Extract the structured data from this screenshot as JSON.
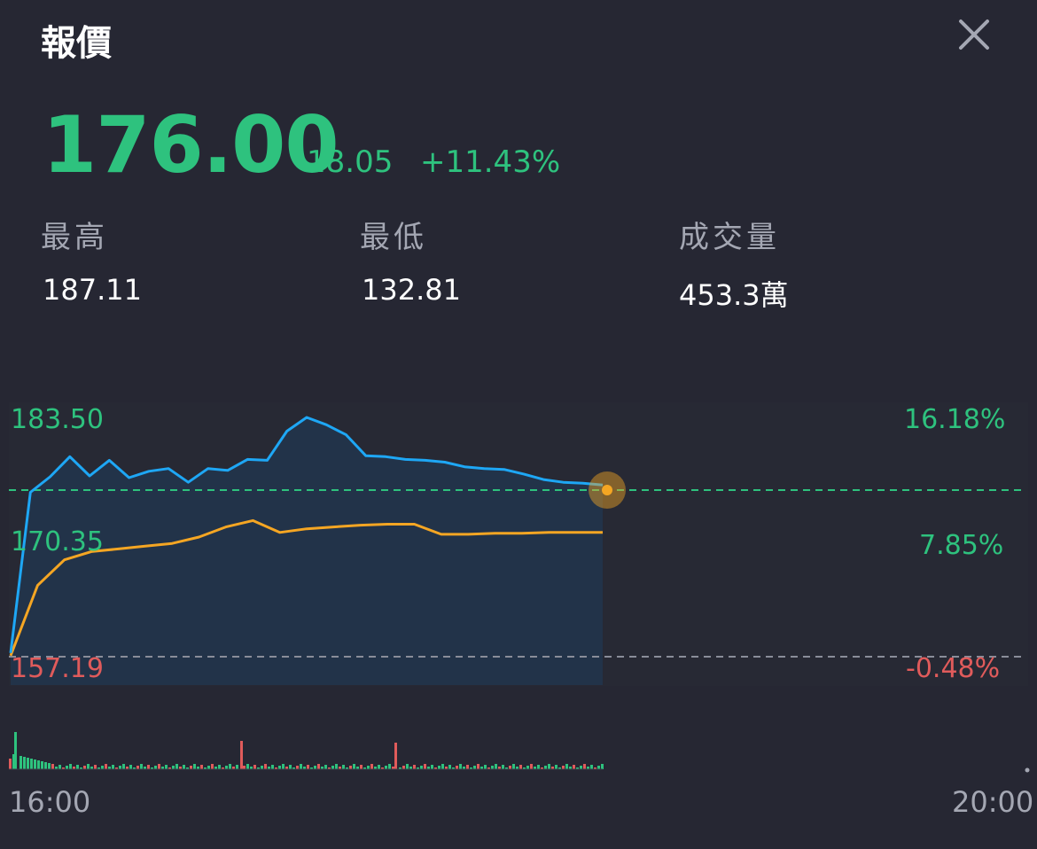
{
  "header": {
    "title": "報價",
    "close_icon": "close-icon"
  },
  "quote": {
    "price": "176.00",
    "change": "18.05",
    "change_pct": "+11.43%"
  },
  "stats": [
    {
      "label": "最高",
      "value": "187.11"
    },
    {
      "label": "最低",
      "value": "132.81"
    },
    {
      "label": "成交量",
      "value": "453.3萬"
    }
  ],
  "chart": {
    "y_labels_left": [
      "183.50",
      "170.35",
      "157.19"
    ],
    "y_labels_right": [
      "16.18%",
      "7.85%",
      "-0.48%"
    ],
    "x_labels": [
      "16:00",
      "20:00"
    ]
  },
  "chart_data": {
    "type": "line",
    "x_range": [
      "16:00",
      "20:00"
    ],
    "ylim": [
      157.19,
      183.5
    ],
    "reference_price": 176.0,
    "series": [
      {
        "color": "#1ea7f5",
        "values": [
          157.6,
          175.2,
          176.9,
          179.1,
          177.0,
          178.7,
          176.8,
          177.5,
          177.8,
          176.3,
          177.8,
          177.6,
          178.8,
          178.7,
          181.9,
          183.4,
          182.6,
          181.5,
          179.2,
          179.1,
          178.8,
          178.7,
          178.5,
          178.0,
          177.8,
          177.7,
          177.2,
          176.6,
          176.3,
          176.2,
          176.0
        ]
      },
      {
        "color": "#f5a623",
        "values": [
          157.3,
          165.0,
          167.8,
          168.7,
          169.0,
          169.3,
          169.6,
          170.3,
          171.4,
          172.1,
          170.8,
          171.2,
          171.4,
          171.6,
          171.7,
          171.7,
          170.6,
          170.6,
          170.7,
          170.7,
          170.8,
          170.8,
          170.8
        ]
      }
    ],
    "volume": {
      "colors": {
        "up": "#2ec27e",
        "down": "#e05b5b"
      }
    }
  }
}
